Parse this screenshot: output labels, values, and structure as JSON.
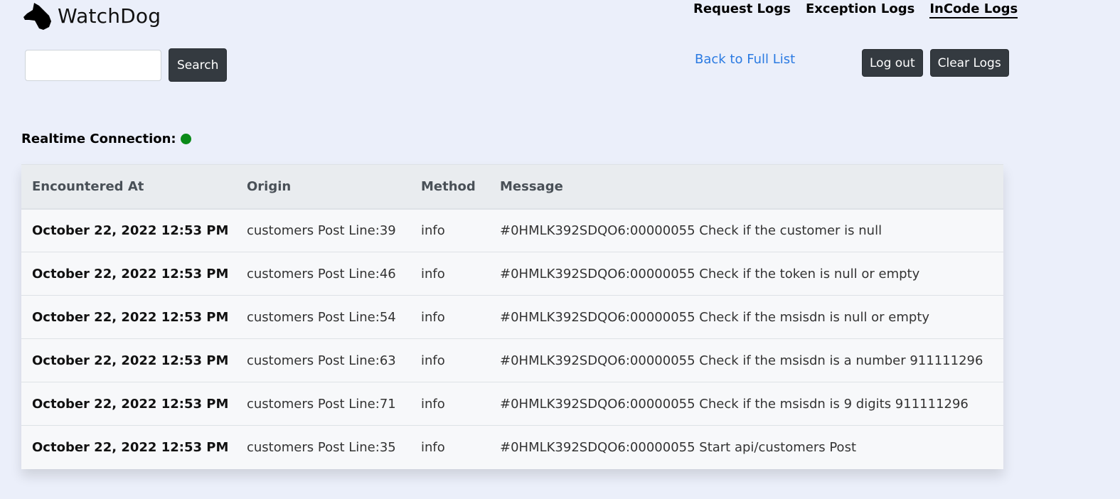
{
  "brand": {
    "name": "WatchDog",
    "logo_icon": "dog-head-icon"
  },
  "nav": {
    "items": [
      {
        "label": "Request Logs",
        "active": false
      },
      {
        "label": "Exception Logs",
        "active": false
      },
      {
        "label": "InCode Logs",
        "active": true
      }
    ]
  },
  "search": {
    "value": "",
    "placeholder": "",
    "button_label": "Search"
  },
  "back_link": "Back to Full List",
  "actions": {
    "logout_label": "Log out",
    "clear_label": "Clear Logs"
  },
  "realtime": {
    "label": "Realtime Connection:",
    "status_color": "#0a8a18"
  },
  "table": {
    "headers": [
      "Encountered At",
      "Origin",
      "Method",
      "Message"
    ],
    "rows": [
      {
        "encountered_at": "October 22, 2022 12:53 PM",
        "origin": "customers Post Line:39",
        "method": "info",
        "message": "#0HMLK392SDQO6:00000055 Check if the customer is null"
      },
      {
        "encountered_at": "October 22, 2022 12:53 PM",
        "origin": "customers Post Line:46",
        "method": "info",
        "message": "#0HMLK392SDQO6:00000055 Check if the token is null or empty"
      },
      {
        "encountered_at": "October 22, 2022 12:53 PM",
        "origin": "customers Post Line:54",
        "method": "info",
        "message": "#0HMLK392SDQO6:00000055 Check if the msisdn is null or empty"
      },
      {
        "encountered_at": "October 22, 2022 12:53 PM",
        "origin": "customers Post Line:63",
        "method": "info",
        "message": "#0HMLK392SDQO6:00000055 Check if the msisdn is a number 911111296"
      },
      {
        "encountered_at": "October 22, 2022 12:53 PM",
        "origin": "customers Post Line:71",
        "method": "info",
        "message": "#0HMLK392SDQO6:00000055 Check if the msisdn is 9 digits 911111296"
      },
      {
        "encountered_at": "October 22, 2022 12:53 PM",
        "origin": "customers Post Line:35",
        "method": "info",
        "message": "#0HMLK392SDQO6:00000055 Start api/customers Post"
      }
    ]
  }
}
